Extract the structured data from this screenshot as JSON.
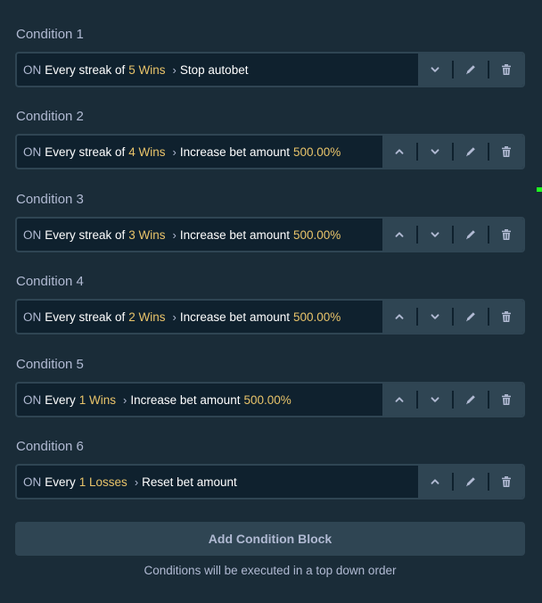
{
  "conditions": [
    {
      "title": "Condition 1",
      "on": "ON",
      "every": "Every streak of",
      "count": "5 Wins",
      "action": "Stop autobet",
      "amount": "",
      "controls": [
        "down",
        "edit",
        "delete"
      ]
    },
    {
      "title": "Condition 2",
      "on": "ON",
      "every": "Every streak of",
      "count": "4 Wins",
      "action": "Increase bet amount",
      "amount": "500.00%",
      "controls": [
        "up",
        "down",
        "edit",
        "delete"
      ]
    },
    {
      "title": "Condition 3",
      "on": "ON",
      "every": "Every streak of",
      "count": "3 Wins",
      "action": "Increase bet amount",
      "amount": "500.00%",
      "controls": [
        "up",
        "down",
        "edit",
        "delete"
      ]
    },
    {
      "title": "Condition 4",
      "on": "ON",
      "every": "Every streak of",
      "count": "2 Wins",
      "action": "Increase bet amount",
      "amount": "500.00%",
      "controls": [
        "up",
        "down",
        "edit",
        "delete"
      ]
    },
    {
      "title": "Condition 5",
      "on": "ON",
      "every": "Every",
      "count": "1 Wins",
      "action": "Increase bet amount",
      "amount": "500.00%",
      "controls": [
        "up",
        "down",
        "edit",
        "delete"
      ]
    },
    {
      "title": "Condition 6",
      "on": "ON",
      "every": "Every",
      "count": "1 Losses",
      "action": "Reset bet amount",
      "amount": "",
      "controls": [
        "up",
        "edit",
        "delete"
      ]
    }
  ],
  "add_button": {
    "label": "Add Condition Block"
  },
  "footer": {
    "note": "Conditions will be executed in a top down order"
  },
  "colors": {
    "background": "#1a2c38",
    "row_bg": "#0f212e",
    "border": "#2f4553",
    "highlight": "#e9c46a",
    "muted_text": "#b1bad3",
    "text": "#ffffff"
  },
  "icons": {
    "up": "chevron-up-icon",
    "down": "chevron-down-icon",
    "edit": "pencil-icon",
    "delete": "trash-icon",
    "separator": "chevron-right-icon"
  }
}
